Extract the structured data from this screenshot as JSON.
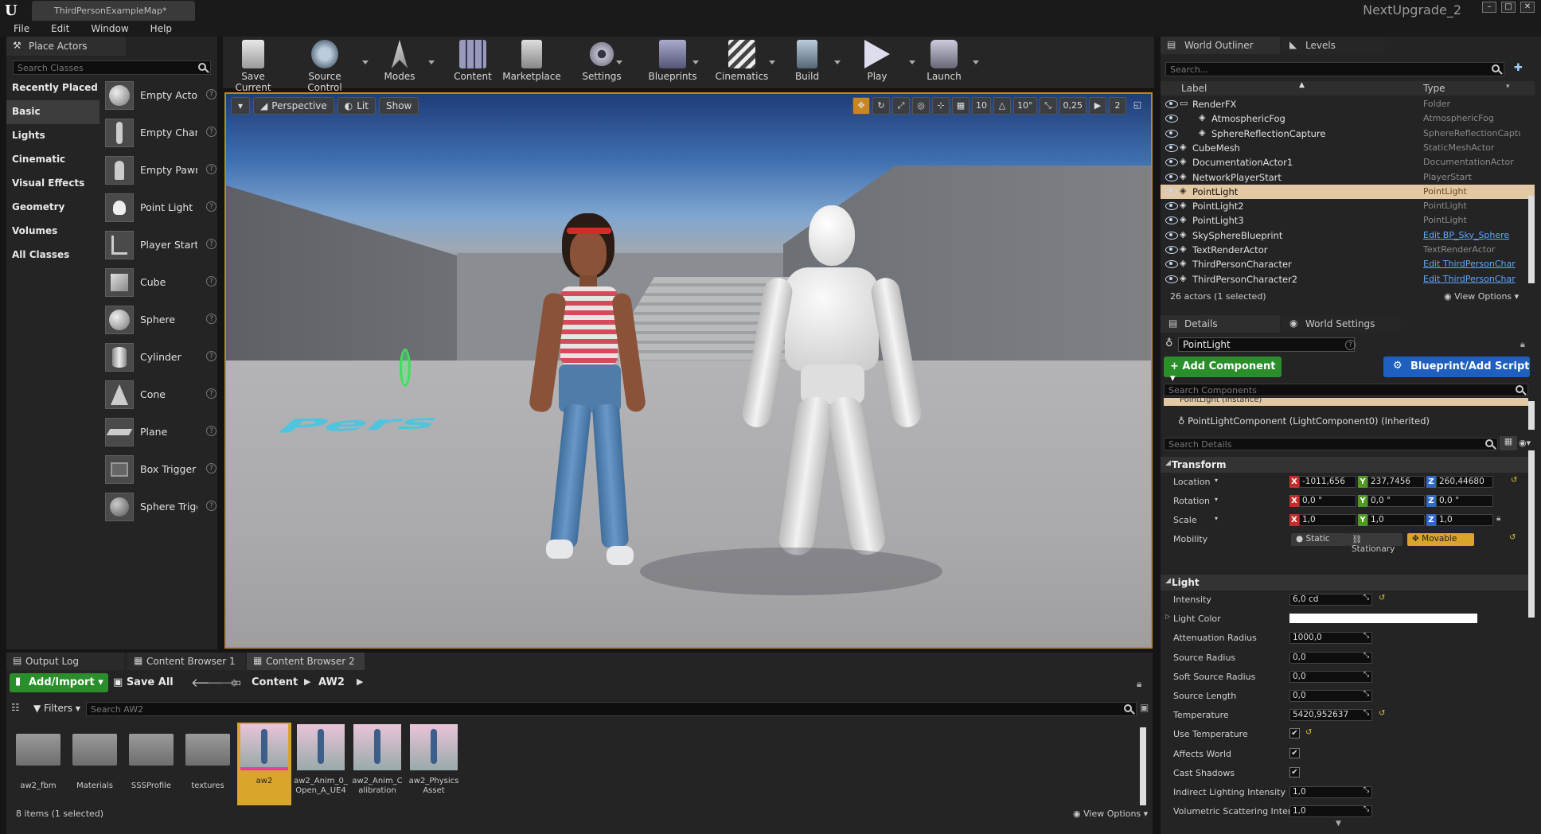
{
  "titlebar": {
    "doc_tab": "ThirdPersonExampleMap*",
    "project": "NextUpgrade_2"
  },
  "menu": [
    "File",
    "Edit",
    "Window",
    "Help"
  ],
  "place_actors": {
    "tab": "Place Actors",
    "search_placeholder": "Search Classes",
    "categories": [
      "Recently Placed",
      "Basic",
      "Lights",
      "Cinematic",
      "Visual Effects",
      "Geometry",
      "Volumes",
      "All Classes"
    ],
    "selected_category": "Basic",
    "actors": [
      "Empty Actor",
      "Empty Chara",
      "Empty Pawn",
      "Point Light",
      "Player Start",
      "Cube",
      "Sphere",
      "Cylinder",
      "Cone",
      "Plane",
      "Box Trigger",
      "Sphere Trigg"
    ]
  },
  "toolbar": [
    "Save Current",
    "Source Control",
    "Modes",
    "Content",
    "Marketplace",
    "Settings",
    "Blueprints",
    "Cinematics",
    "Build",
    "Play",
    "Launch"
  ],
  "viewport": {
    "perspective": "Perspective",
    "lit": "Lit",
    "show": "Show",
    "grid_snap": "10",
    "rot_snap": "10°",
    "scale_snap": "0,25",
    "cam_speed": "2",
    "floor_text": "Pers"
  },
  "bottom": {
    "tabs": [
      "Output Log",
      "Content Browser 1",
      "Content Browser 2"
    ],
    "add_import": "Add/Import",
    "save_all": "Save All",
    "path": [
      "Content",
      "AW2"
    ],
    "filters": "Filters",
    "search_placeholder": "Search AW2",
    "items": [
      "aw2_fbm",
      "Materials",
      "SSSProfile",
      "textures",
      "aw2",
      "aw2_Anim_0_Open_A_UE4",
      "aw2_Anim_Calibration",
      "aw2_Physics Asset"
    ],
    "item_count": "8 items (1 selected)",
    "view_options": "View Options"
  },
  "outliner": {
    "tabs": [
      "World Outliner",
      "Levels"
    ],
    "search_placeholder": "Search...",
    "col_label": "Label",
    "col_type": "Type",
    "rows": [
      {
        "label": "RenderFX",
        "type": "Folder"
      },
      {
        "label": "AtmosphericFog",
        "type": "AtmosphericFog"
      },
      {
        "label": "SphereReflectionCapture",
        "type": "SphereReflectionCaptu"
      },
      {
        "label": "CubeMesh",
        "type": "StaticMeshActor"
      },
      {
        "label": "DocumentationActor1",
        "type": "DocumentationActor"
      },
      {
        "label": "NetworkPlayerStart",
        "type": "PlayerStart"
      },
      {
        "label": "PointLight",
        "type": "PointLight"
      },
      {
        "label": "PointLight2",
        "type": "PointLight"
      },
      {
        "label": "PointLight3",
        "type": "PointLight"
      },
      {
        "label": "SkySphereBlueprint",
        "type": "Edit BP_Sky_Sphere"
      },
      {
        "label": "TextRenderActor",
        "type": "TextRenderActor"
      },
      {
        "label": "ThirdPersonCharacter",
        "type": "Edit ThirdPersonChar"
      },
      {
        "label": "ThirdPersonCharacter2",
        "type": "Edit ThirdPersonChar"
      }
    ],
    "footer": "26 actors (1 selected)",
    "view_options": "View Options"
  },
  "details": {
    "tabs": [
      "Details",
      "World Settings"
    ],
    "name": "PointLight",
    "add_component": "+ Add Component",
    "blueprint": "Blueprint/Add Script",
    "search_components": "Search Components",
    "instance": "PointLight (Instance)",
    "component": "PointLightComponent (LightComponent0) (Inherited)",
    "search_details": "Search Details",
    "transform": "Transform",
    "location_label": "Location",
    "location": [
      "-1011,656",
      "237,7456",
      "260,44680"
    ],
    "rotation_label": "Rotation",
    "rotation": [
      "0,0 °",
      "0,0 °",
      "0,0 °"
    ],
    "scale_label": "Scale",
    "scale": [
      "1,0",
      "1,0",
      "1,0"
    ],
    "mobility_label": "Mobility",
    "mobility": [
      "Static",
      "Stationary",
      "Movable"
    ],
    "light": "Light",
    "props": [
      {
        "label": "Intensity",
        "value": "6,0 cd"
      },
      {
        "label": "Light Color",
        "value": ""
      },
      {
        "label": "Attenuation Radius",
        "value": "1000,0"
      },
      {
        "label": "Source Radius",
        "value": "0,0"
      },
      {
        "label": "Soft Source Radius",
        "value": "0,0"
      },
      {
        "label": "Source Length",
        "value": "0,0"
      },
      {
        "label": "Temperature",
        "value": "5420,952637"
      },
      {
        "label": "Use Temperature",
        "value": "✔"
      },
      {
        "label": "Affects World",
        "value": "✔"
      },
      {
        "label": "Cast Shadows",
        "value": "✔"
      },
      {
        "label": "Indirect Lighting Intensity",
        "value": "1,0"
      },
      {
        "label": "Volumetric Scattering Intens",
        "value": "1,0"
      }
    ]
  },
  "colors": {
    "accent": "#b98a1f",
    "green_btn": "#2a8f2a",
    "blue_btn": "#1f5fbf",
    "selected_row": "#e2c8a3"
  }
}
